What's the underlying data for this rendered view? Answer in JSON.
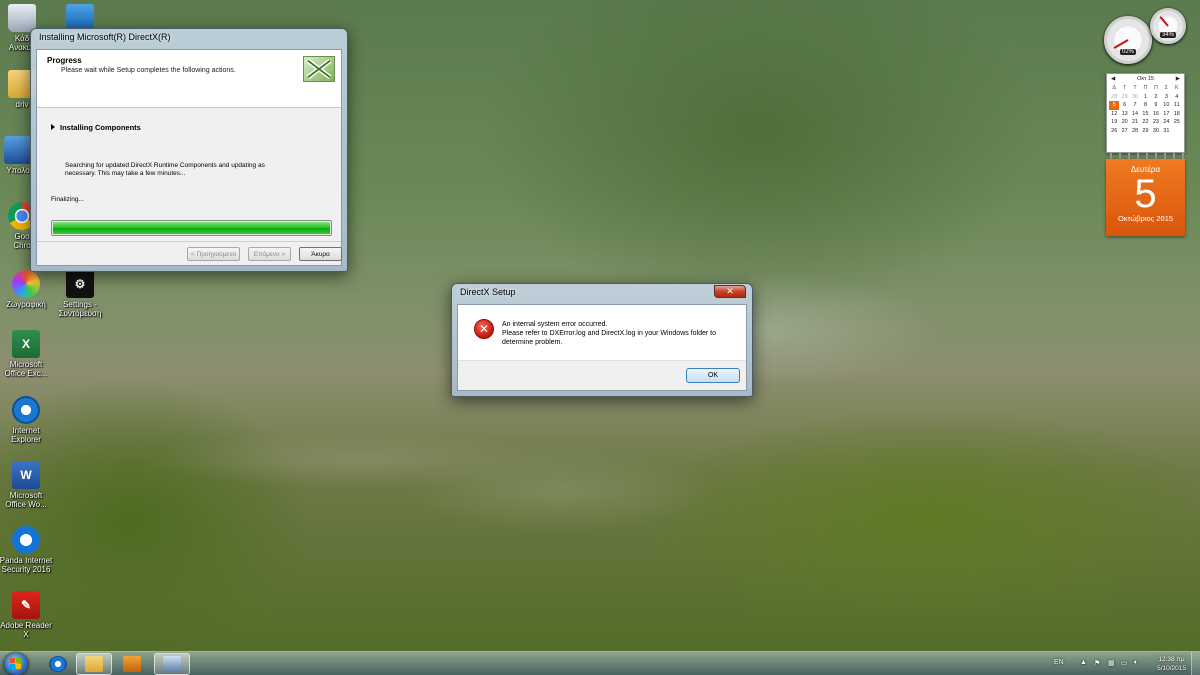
{
  "desktop": {
    "icons": [
      {
        "label": "Κάδ\nΑνακυκ",
        "icon": "recycle-bin-icon"
      },
      {
        "label": "",
        "icon": "network-icon"
      },
      {
        "label": "driv",
        "icon": "folder-icon"
      },
      {
        "label": "Υπολο",
        "icon": "computer-icon"
      },
      {
        "label": "Goo\nChro",
        "icon": "chrome-icon"
      },
      {
        "label": "Ζωγραφική",
        "icon": "paint-icon"
      },
      {
        "label": "Settings -\nΣυντόμευση",
        "icon": "settings-icon"
      },
      {
        "label": "Microsoft\nOffice Exc...",
        "icon": "excel-icon"
      },
      {
        "label": "Internet\nExplorer",
        "icon": "internet-explorer-icon"
      },
      {
        "label": "Microsoft\nOffice Wo...",
        "icon": "word-icon"
      },
      {
        "label": "Panda Internet\nSecurity 2016",
        "icon": "panda-icon"
      },
      {
        "label": "Adobe Reader\nX",
        "icon": "adobe-reader-icon"
      }
    ]
  },
  "installer": {
    "title": "Installing Microsoft(R) DirectX(R)",
    "header_title": "Progress",
    "header_subtitle": "Please wait while Setup completes the following actions.",
    "section": "Installing Components",
    "description": "Searching for updated DirectX Runtime Components and updating as necessary. This may take a few minutes...",
    "status": "Finalizing...",
    "progress": 1.0,
    "back_label": "< Προηγούμενο",
    "next_label": "Επόμενο >",
    "cancel_label": "Άκυρο"
  },
  "error_dialog": {
    "title": "DirectX Setup",
    "line1": "An internal system error occurred.",
    "line2": "Please refer to DXError.log and DirectX.log in your Windows folder to determine problem.",
    "ok_label": "OK"
  },
  "gadgets": {
    "cpu_percent": "02%",
    "mem_percent": "34%",
    "calendar": {
      "month_label": "Oκτ 15",
      "weekday_headers": [
        "Δ",
        "Τ",
        "Τ",
        "Π",
        "Π",
        "Σ",
        "Κ"
      ],
      "weeks": [
        [
          "28",
          "29",
          "30",
          "1",
          "2",
          "3",
          "4"
        ],
        [
          "5",
          "6",
          "7",
          "8",
          "9",
          "10",
          "11"
        ],
        [
          "12",
          "13",
          "14",
          "15",
          "16",
          "17",
          "18"
        ],
        [
          "19",
          "20",
          "21",
          "22",
          "23",
          "24",
          "25"
        ],
        [
          "26",
          "27",
          "28",
          "29",
          "30",
          "31",
          ""
        ]
      ],
      "weekday": "Δευτέρα",
      "day": "5",
      "month_year": "Οκτώβριος 2015"
    }
  },
  "taskbar": {
    "language": "EN",
    "time": "12:38 πμ",
    "date": "5/10/2015"
  },
  "colors": {
    "progress_green": "#17b517",
    "calendar_orange": "#e8680f",
    "error_red": "#c4160a"
  }
}
